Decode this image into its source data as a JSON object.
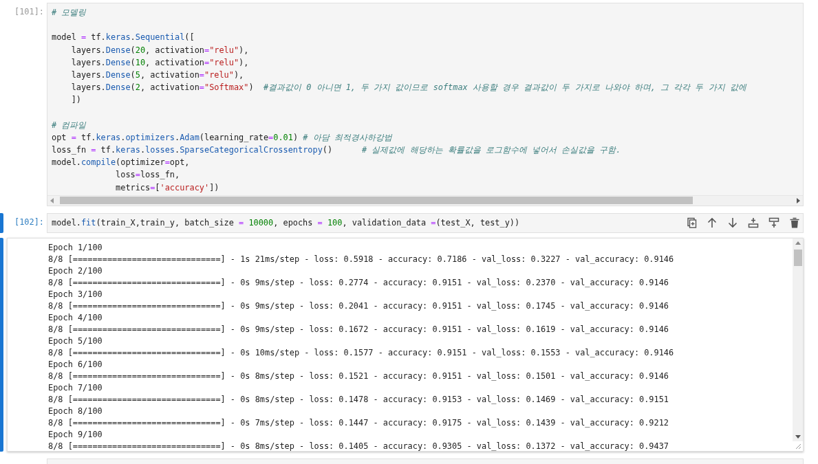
{
  "cells": [
    {
      "prompt": "[101]:",
      "selected": false,
      "code_blocks": [
        [
          {
            "tokens": [
              {
                "kind": "comment",
                "t": "# 모델링"
              }
            ]
          }
        ],
        [
          {
            "tokens": [
              {
                "kind": "plain",
                "t": "model "
              },
              {
                "kind": "op",
                "t": "="
              },
              {
                "kind": "plain",
                "t": " tf."
              },
              {
                "kind": "attr",
                "t": "keras"
              },
              {
                "kind": "plain",
                "t": "."
              },
              {
                "kind": "attr",
                "t": "Sequential"
              },
              {
                "kind": "plain",
                "t": "(["
              }
            ]
          },
          {
            "tokens": [
              {
                "kind": "plain",
                "t": "    layers."
              },
              {
                "kind": "attr",
                "t": "Dense"
              },
              {
                "kind": "plain",
                "t": "("
              },
              {
                "kind": "num",
                "t": "20"
              },
              {
                "kind": "plain",
                "t": ", activation"
              },
              {
                "kind": "op",
                "t": "="
              },
              {
                "kind": "str",
                "t": "\"relu\""
              },
              {
                "kind": "plain",
                "t": "),"
              }
            ]
          },
          {
            "tokens": [
              {
                "kind": "plain",
                "t": "    layers."
              },
              {
                "kind": "attr",
                "t": "Dense"
              },
              {
                "kind": "plain",
                "t": "("
              },
              {
                "kind": "num",
                "t": "10"
              },
              {
                "kind": "plain",
                "t": ", activation"
              },
              {
                "kind": "op",
                "t": "="
              },
              {
                "kind": "str",
                "t": "\"relu\""
              },
              {
                "kind": "plain",
                "t": "),"
              }
            ]
          },
          {
            "tokens": [
              {
                "kind": "plain",
                "t": "    layers."
              },
              {
                "kind": "attr",
                "t": "Dense"
              },
              {
                "kind": "plain",
                "t": "("
              },
              {
                "kind": "num",
                "t": "5"
              },
              {
                "kind": "plain",
                "t": ", activation"
              },
              {
                "kind": "op",
                "t": "="
              },
              {
                "kind": "str",
                "t": "\"relu\""
              },
              {
                "kind": "plain",
                "t": "),"
              }
            ]
          },
          {
            "tokens": [
              {
                "kind": "plain",
                "t": "    layers."
              },
              {
                "kind": "attr",
                "t": "Dense"
              },
              {
                "kind": "plain",
                "t": "("
              },
              {
                "kind": "num",
                "t": "2"
              },
              {
                "kind": "plain",
                "t": ", activation"
              },
              {
                "kind": "op",
                "t": "="
              },
              {
                "kind": "str",
                "t": "\"Softmax\""
              },
              {
                "kind": "plain",
                "t": ")  "
              },
              {
                "kind": "comment",
                "t": "#결과값이 0 아니면 1, 두 가지 값이므로 softmax 사용할 경우 결과값이 두 가지로 나와야 하며, 그 각각 두 가지 값에"
              }
            ]
          },
          {
            "tokens": [
              {
                "kind": "plain",
                "t": "    ])"
              }
            ]
          }
        ],
        [
          {
            "tokens": [
              {
                "kind": "comment",
                "t": "# 컴파일"
              }
            ]
          },
          {
            "tokens": [
              {
                "kind": "plain",
                "t": "opt "
              },
              {
                "kind": "op",
                "t": "="
              },
              {
                "kind": "plain",
                "t": " tf."
              },
              {
                "kind": "attr",
                "t": "keras"
              },
              {
                "kind": "plain",
                "t": "."
              },
              {
                "kind": "attr",
                "t": "optimizers"
              },
              {
                "kind": "plain",
                "t": "."
              },
              {
                "kind": "attr",
                "t": "Adam"
              },
              {
                "kind": "plain",
                "t": "(learning_rate"
              },
              {
                "kind": "op",
                "t": "="
              },
              {
                "kind": "num",
                "t": "0.01"
              },
              {
                "kind": "plain",
                "t": ") "
              },
              {
                "kind": "comment",
                "t": "# 아담 최적경사하강법"
              }
            ]
          },
          {
            "tokens": [
              {
                "kind": "plain",
                "t": "loss_fn "
              },
              {
                "kind": "op",
                "t": "="
              },
              {
                "kind": "plain",
                "t": " tf."
              },
              {
                "kind": "attr",
                "t": "keras"
              },
              {
                "kind": "plain",
                "t": "."
              },
              {
                "kind": "attr",
                "t": "losses"
              },
              {
                "kind": "plain",
                "t": "."
              },
              {
                "kind": "attr",
                "t": "SparseCategoricalCrossentropy"
              },
              {
                "kind": "plain",
                "t": "()      "
              },
              {
                "kind": "comment",
                "t": "# 실제값에 해당하는 확률값을 로그함수에 넣어서 손실값을 구함."
              }
            ]
          },
          {
            "tokens": [
              {
                "kind": "plain",
                "t": "model."
              },
              {
                "kind": "attr",
                "t": "compile"
              },
              {
                "kind": "plain",
                "t": "(optimizer"
              },
              {
                "kind": "op",
                "t": "="
              },
              {
                "kind": "plain",
                "t": "opt,"
              }
            ]
          },
          {
            "tokens": [
              {
                "kind": "plain",
                "t": "             loss"
              },
              {
                "kind": "op",
                "t": "="
              },
              {
                "kind": "plain",
                "t": "loss_fn,"
              }
            ]
          },
          {
            "tokens": [
              {
                "kind": "plain",
                "t": "             metrics"
              },
              {
                "kind": "op",
                "t": "="
              },
              {
                "kind": "plain",
                "t": "["
              },
              {
                "kind": "str",
                "t": "'accuracy'"
              },
              {
                "kind": "plain",
                "t": "])"
              }
            ]
          }
        ]
      ]
    },
    {
      "prompt": "[102]:",
      "selected": true,
      "code_blocks": [
        [
          {
            "tokens": [
              {
                "kind": "plain",
                "t": "model."
              },
              {
                "kind": "attr",
                "t": "fit"
              },
              {
                "kind": "plain",
                "t": "(train_X,train_y, batch_size "
              },
              {
                "kind": "op",
                "t": "= "
              },
              {
                "kind": "num",
                "t": "10000"
              },
              {
                "kind": "plain",
                "t": ", epochs "
              },
              {
                "kind": "op",
                "t": "= "
              },
              {
                "kind": "num",
                "t": "100"
              },
              {
                "kind": "plain",
                "t": ", validation_data "
              },
              {
                "kind": "op",
                "t": "="
              },
              {
                "kind": "plain",
                "t": "(test_X, test_y))"
              }
            ]
          }
        ]
      ],
      "output": [
        "Epoch 1/100",
        "8/8 [==============================] - 1s 21ms/step - loss: 0.5918 - accuracy: 0.7186 - val_loss: 0.3227 - val_accuracy: 0.9146",
        "Epoch 2/100",
        "8/8 [==============================] - 0s 9ms/step - loss: 0.2774 - accuracy: 0.9151 - val_loss: 0.2370 - val_accuracy: 0.9146",
        "Epoch 3/100",
        "8/8 [==============================] - 0s 9ms/step - loss: 0.2041 - accuracy: 0.9151 - val_loss: 0.1745 - val_accuracy: 0.9146",
        "Epoch 4/100",
        "8/8 [==============================] - 0s 9ms/step - loss: 0.1672 - accuracy: 0.9151 - val_loss: 0.1619 - val_accuracy: 0.9146",
        "Epoch 5/100",
        "8/8 [==============================] - 0s 10ms/step - loss: 0.1577 - accuracy: 0.9151 - val_loss: 0.1553 - val_accuracy: 0.9146",
        "Epoch 6/100",
        "8/8 [==============================] - 0s 8ms/step - loss: 0.1521 - accuracy: 0.9151 - val_loss: 0.1501 - val_accuracy: 0.9146",
        "Epoch 7/100",
        "8/8 [==============================] - 0s 8ms/step - loss: 0.1478 - accuracy: 0.9153 - val_loss: 0.1469 - val_accuracy: 0.9151",
        "Epoch 8/100",
        "8/8 [==============================] - 0s 7ms/step - loss: 0.1447 - accuracy: 0.9175 - val_loss: 0.1439 - val_accuracy: 0.9212",
        "Epoch 9/100",
        "8/8 [==============================] - 0s 8ms/step - loss: 0.1405 - accuracy: 0.9305 - val_loss: 0.1372 - val_accuracy: 0.9437"
      ]
    }
  ]
}
